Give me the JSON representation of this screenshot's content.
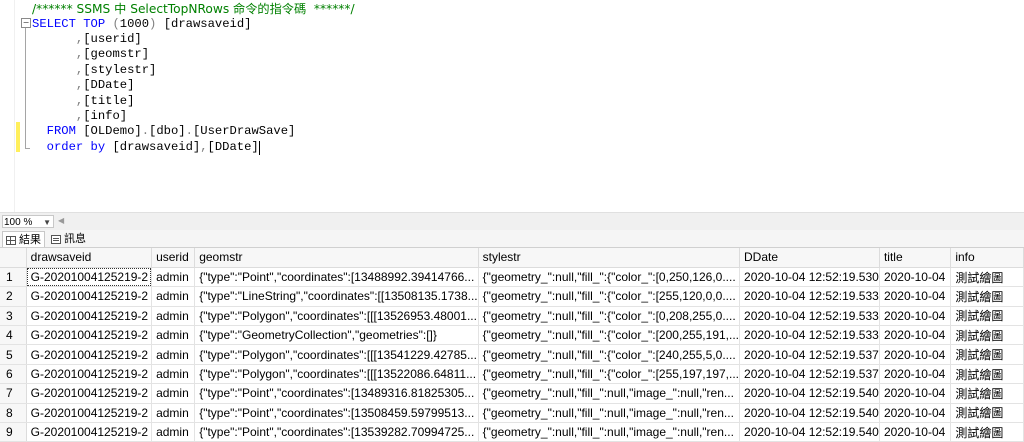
{
  "editor": {
    "lines": [
      {
        "parts": [
          {
            "t": "/****** SSMS 中 SelectTopNRows 命令的指令碼  ******/",
            "c": "cm"
          }
        ]
      },
      {
        "parts": [
          {
            "t": "SELECT TOP ",
            "c": "kw"
          },
          {
            "t": "(",
            "c": "op"
          },
          {
            "t": "1000",
            "c": "id"
          },
          {
            "t": ")",
            "c": "op"
          },
          {
            "t": " [drawsaveid]",
            "c": "id"
          }
        ]
      },
      {
        "parts": [
          {
            "t": "      ",
            "c": "id"
          },
          {
            "t": ",",
            "c": "op"
          },
          {
            "t": "[userid]",
            "c": "id"
          }
        ]
      },
      {
        "parts": [
          {
            "t": "      ",
            "c": "id"
          },
          {
            "t": ",",
            "c": "op"
          },
          {
            "t": "[geomstr]",
            "c": "id"
          }
        ]
      },
      {
        "parts": [
          {
            "t": "      ",
            "c": "id"
          },
          {
            "t": ",",
            "c": "op"
          },
          {
            "t": "[stylestr]",
            "c": "id"
          }
        ]
      },
      {
        "parts": [
          {
            "t": "      ",
            "c": "id"
          },
          {
            "t": ",",
            "c": "op"
          },
          {
            "t": "[DDate]",
            "c": "id"
          }
        ]
      },
      {
        "parts": [
          {
            "t": "      ",
            "c": "id"
          },
          {
            "t": ",",
            "c": "op"
          },
          {
            "t": "[title]",
            "c": "id"
          }
        ]
      },
      {
        "parts": [
          {
            "t": "      ",
            "c": "id"
          },
          {
            "t": ",",
            "c": "op"
          },
          {
            "t": "[info]",
            "c": "id"
          }
        ]
      },
      {
        "parts": [
          {
            "t": "  FROM ",
            "c": "kw"
          },
          {
            "t": "[OLDemo]",
            "c": "id"
          },
          {
            "t": ".",
            "c": "op"
          },
          {
            "t": "[dbo]",
            "c": "id"
          },
          {
            "t": ".",
            "c": "op"
          },
          {
            "t": "[UserDrawSave]",
            "c": "id"
          }
        ]
      },
      {
        "parts": [
          {
            "t": "  order by ",
            "c": "kw"
          },
          {
            "t": "[drawsaveid]",
            "c": "id"
          },
          {
            "t": ",",
            "c": "op"
          },
          {
            "t": "[DDate]",
            "c": "id"
          }
        ]
      }
    ]
  },
  "zoom": {
    "value": "100 %"
  },
  "tabs": {
    "results": "結果",
    "messages": "訊息"
  },
  "grid": {
    "columns": [
      "drawsaveid",
      "userid",
      "geomstr",
      "stylestr",
      "DDate",
      "title",
      "info"
    ],
    "rows": [
      [
        "1",
        "G-20201004125219-2",
        "admin",
        "{\"type\":\"Point\",\"coordinates\":[13488992.39414766...",
        "{\"geometry_\":null,\"fill_\":{\"color_\":[0,250,126,0....",
        "2020-10-04 12:52:19.530",
        "2020-10-04",
        "測試繪圖"
      ],
      [
        "2",
        "G-20201004125219-2",
        "admin",
        "{\"type\":\"LineString\",\"coordinates\":[[13508135.1738...",
        "{\"geometry_\":null,\"fill_\":{\"color_\":[255,120,0,0....",
        "2020-10-04 12:52:19.533",
        "2020-10-04",
        "測試繪圖"
      ],
      [
        "3",
        "G-20201004125219-2",
        "admin",
        "{\"type\":\"Polygon\",\"coordinates\":[[[13526953.48001...",
        "{\"geometry_\":null,\"fill_\":{\"color_\":[0,208,255,0....",
        "2020-10-04 12:52:19.533",
        "2020-10-04",
        "測試繪圖"
      ],
      [
        "4",
        "G-20201004125219-2",
        "admin",
        "{\"type\":\"GeometryCollection\",\"geometries\":[]}",
        "{\"geometry_\":null,\"fill_\":{\"color_\":[200,255,191,...",
        "2020-10-04 12:52:19.533",
        "2020-10-04",
        "測試繪圖"
      ],
      [
        "5",
        "G-20201004125219-2",
        "admin",
        "{\"type\":\"Polygon\",\"coordinates\":[[[13541229.42785...",
        "{\"geometry_\":null,\"fill_\":{\"color_\":[240,255,5,0....",
        "2020-10-04 12:52:19.537",
        "2020-10-04",
        "測試繪圖"
      ],
      [
        "6",
        "G-20201004125219-2",
        "admin",
        "{\"type\":\"Polygon\",\"coordinates\":[[[13522086.64811...",
        "{\"geometry_\":null,\"fill_\":{\"color_\":[255,197,197,...",
        "2020-10-04 12:52:19.537",
        "2020-10-04",
        "測試繪圖"
      ],
      [
        "7",
        "G-20201004125219-2",
        "admin",
        "{\"type\":\"Point\",\"coordinates\":[13489316.81825305...",
        "{\"geometry_\":null,\"fill_\":null,\"image_\":null,\"ren...",
        "2020-10-04 12:52:19.540",
        "2020-10-04",
        "測試繪圖"
      ],
      [
        "8",
        "G-20201004125219-2",
        "admin",
        "{\"type\":\"Point\",\"coordinates\":[13508459.59799513...",
        "{\"geometry_\":null,\"fill_\":null,\"image_\":null,\"ren...",
        "2020-10-04 12:52:19.540",
        "2020-10-04",
        "測試繪圖"
      ],
      [
        "9",
        "G-20201004125219-2",
        "admin",
        "{\"type\":\"Point\",\"coordinates\":[13539282.70994725...",
        "{\"geometry_\":null,\"fill_\":null,\"image_\":null,\"ren...",
        "2020-10-04 12:52:19.540",
        "2020-10-04",
        "測試繪圖"
      ]
    ]
  }
}
